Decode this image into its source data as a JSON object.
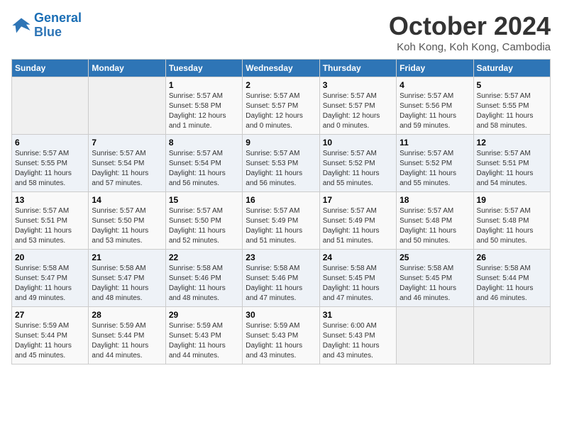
{
  "logo": {
    "line1": "General",
    "line2": "Blue"
  },
  "title": "October 2024",
  "location": "Koh Kong, Koh Kong, Cambodia",
  "weekdays": [
    "Sunday",
    "Monday",
    "Tuesday",
    "Wednesday",
    "Thursday",
    "Friday",
    "Saturday"
  ],
  "weeks": [
    [
      {
        "day": "",
        "info": ""
      },
      {
        "day": "",
        "info": ""
      },
      {
        "day": "1",
        "info": "Sunrise: 5:57 AM\nSunset: 5:58 PM\nDaylight: 12 hours\nand 1 minute."
      },
      {
        "day": "2",
        "info": "Sunrise: 5:57 AM\nSunset: 5:57 PM\nDaylight: 12 hours\nand 0 minutes."
      },
      {
        "day": "3",
        "info": "Sunrise: 5:57 AM\nSunset: 5:57 PM\nDaylight: 12 hours\nand 0 minutes."
      },
      {
        "day": "4",
        "info": "Sunrise: 5:57 AM\nSunset: 5:56 PM\nDaylight: 11 hours\nand 59 minutes."
      },
      {
        "day": "5",
        "info": "Sunrise: 5:57 AM\nSunset: 5:55 PM\nDaylight: 11 hours\nand 58 minutes."
      }
    ],
    [
      {
        "day": "6",
        "info": "Sunrise: 5:57 AM\nSunset: 5:55 PM\nDaylight: 11 hours\nand 58 minutes."
      },
      {
        "day": "7",
        "info": "Sunrise: 5:57 AM\nSunset: 5:54 PM\nDaylight: 11 hours\nand 57 minutes."
      },
      {
        "day": "8",
        "info": "Sunrise: 5:57 AM\nSunset: 5:54 PM\nDaylight: 11 hours\nand 56 minutes."
      },
      {
        "day": "9",
        "info": "Sunrise: 5:57 AM\nSunset: 5:53 PM\nDaylight: 11 hours\nand 56 minutes."
      },
      {
        "day": "10",
        "info": "Sunrise: 5:57 AM\nSunset: 5:52 PM\nDaylight: 11 hours\nand 55 minutes."
      },
      {
        "day": "11",
        "info": "Sunrise: 5:57 AM\nSunset: 5:52 PM\nDaylight: 11 hours\nand 55 minutes."
      },
      {
        "day": "12",
        "info": "Sunrise: 5:57 AM\nSunset: 5:51 PM\nDaylight: 11 hours\nand 54 minutes."
      }
    ],
    [
      {
        "day": "13",
        "info": "Sunrise: 5:57 AM\nSunset: 5:51 PM\nDaylight: 11 hours\nand 53 minutes."
      },
      {
        "day": "14",
        "info": "Sunrise: 5:57 AM\nSunset: 5:50 PM\nDaylight: 11 hours\nand 53 minutes."
      },
      {
        "day": "15",
        "info": "Sunrise: 5:57 AM\nSunset: 5:50 PM\nDaylight: 11 hours\nand 52 minutes."
      },
      {
        "day": "16",
        "info": "Sunrise: 5:57 AM\nSunset: 5:49 PM\nDaylight: 11 hours\nand 51 minutes."
      },
      {
        "day": "17",
        "info": "Sunrise: 5:57 AM\nSunset: 5:49 PM\nDaylight: 11 hours\nand 51 minutes."
      },
      {
        "day": "18",
        "info": "Sunrise: 5:57 AM\nSunset: 5:48 PM\nDaylight: 11 hours\nand 50 minutes."
      },
      {
        "day": "19",
        "info": "Sunrise: 5:57 AM\nSunset: 5:48 PM\nDaylight: 11 hours\nand 50 minutes."
      }
    ],
    [
      {
        "day": "20",
        "info": "Sunrise: 5:58 AM\nSunset: 5:47 PM\nDaylight: 11 hours\nand 49 minutes."
      },
      {
        "day": "21",
        "info": "Sunrise: 5:58 AM\nSunset: 5:47 PM\nDaylight: 11 hours\nand 48 minutes."
      },
      {
        "day": "22",
        "info": "Sunrise: 5:58 AM\nSunset: 5:46 PM\nDaylight: 11 hours\nand 48 minutes."
      },
      {
        "day": "23",
        "info": "Sunrise: 5:58 AM\nSunset: 5:46 PM\nDaylight: 11 hours\nand 47 minutes."
      },
      {
        "day": "24",
        "info": "Sunrise: 5:58 AM\nSunset: 5:45 PM\nDaylight: 11 hours\nand 47 minutes."
      },
      {
        "day": "25",
        "info": "Sunrise: 5:58 AM\nSunset: 5:45 PM\nDaylight: 11 hours\nand 46 minutes."
      },
      {
        "day": "26",
        "info": "Sunrise: 5:58 AM\nSunset: 5:44 PM\nDaylight: 11 hours\nand 46 minutes."
      }
    ],
    [
      {
        "day": "27",
        "info": "Sunrise: 5:59 AM\nSunset: 5:44 PM\nDaylight: 11 hours\nand 45 minutes."
      },
      {
        "day": "28",
        "info": "Sunrise: 5:59 AM\nSunset: 5:44 PM\nDaylight: 11 hours\nand 44 minutes."
      },
      {
        "day": "29",
        "info": "Sunrise: 5:59 AM\nSunset: 5:43 PM\nDaylight: 11 hours\nand 44 minutes."
      },
      {
        "day": "30",
        "info": "Sunrise: 5:59 AM\nSunset: 5:43 PM\nDaylight: 11 hours\nand 43 minutes."
      },
      {
        "day": "31",
        "info": "Sunrise: 6:00 AM\nSunset: 5:43 PM\nDaylight: 11 hours\nand 43 minutes."
      },
      {
        "day": "",
        "info": ""
      },
      {
        "day": "",
        "info": ""
      }
    ]
  ]
}
